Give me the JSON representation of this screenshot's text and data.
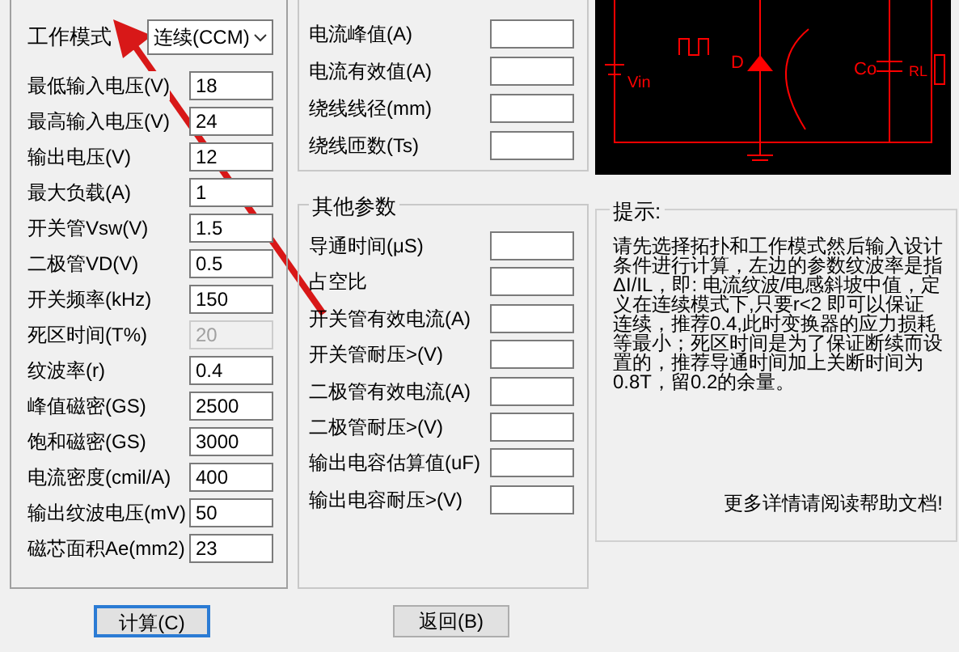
{
  "mode": {
    "label": "工作模式",
    "value": "连续(CCM)"
  },
  "inputs": [
    {
      "label": "最低输入电压(V)",
      "value": "18",
      "disabled": false
    },
    {
      "label": "最高输入电压(V)",
      "value": "24",
      "disabled": false
    },
    {
      "label": "输出电压(V)",
      "value": "12",
      "disabled": false
    },
    {
      "label": "最大负载(A)",
      "value": "1",
      "disabled": false
    },
    {
      "label": "开关管Vsw(V)",
      "value": "1.5",
      "disabled": false
    },
    {
      "label": "二极管VD(V)",
      "value": "0.5",
      "disabled": false
    },
    {
      "label": "开关频率(kHz)",
      "value": "150",
      "disabled": false
    },
    {
      "label": "死区时间(T%)",
      "value": "20",
      "disabled": true
    },
    {
      "label": "纹波率(r)",
      "value": "0.4",
      "disabled": false
    },
    {
      "label": "峰值磁密(GS)",
      "value": "2500",
      "disabled": false
    },
    {
      "label": "饱和磁密(GS)",
      "value": "3000",
      "disabled": false
    },
    {
      "label": "电流密度(cmil/A)",
      "value": "400",
      "disabled": false
    },
    {
      "label": "输出纹波电压(mV)",
      "value": "50",
      "disabled": false
    },
    {
      "label": "磁芯面积Ae(mm2)",
      "value": "23",
      "disabled": false
    }
  ],
  "inductor_outputs": [
    {
      "label": "电流峰值(A)"
    },
    {
      "label": "电流有效值(A)"
    },
    {
      "label": "绕线线径(mm)"
    },
    {
      "label": "绕线匝数(Ts)"
    }
  ],
  "other_params": {
    "title": "其他参数",
    "rows": [
      {
        "label": "导通时间(μS)"
      },
      {
        "label": "占空比"
      },
      {
        "label": "开关管有效电流(A)"
      },
      {
        "label": "开关管耐压>(V)"
      },
      {
        "label": "二极管有效电流(A)"
      },
      {
        "label": "二极管耐压>(V)"
      },
      {
        "label": "输出电容估算值(uF)"
      },
      {
        "label": "输出电容耐压>(V)"
      }
    ]
  },
  "circuit": {
    "labels": [
      "Vin",
      "D",
      "Co",
      "RL"
    ]
  },
  "tips": {
    "title": "提示:",
    "text": "请先选择拓扑和工作模式然后输入设计条件进行计算，左边的参数纹波率是指 ΔI/IL，即: 电流纹波/电感斜坡中值，定义在连续模式下,只要r<2 即可以保证连续，推荐0.4,此时变换器的应力损耗等最小；死区时间是为了保证断续而设置的，推荐导通时间加上关断时间为0.8T，留0.2的余量。",
    "more": "更多详情请阅读帮助文档!"
  },
  "buttons": [
    "计算(C)",
    "返回(B)"
  ]
}
